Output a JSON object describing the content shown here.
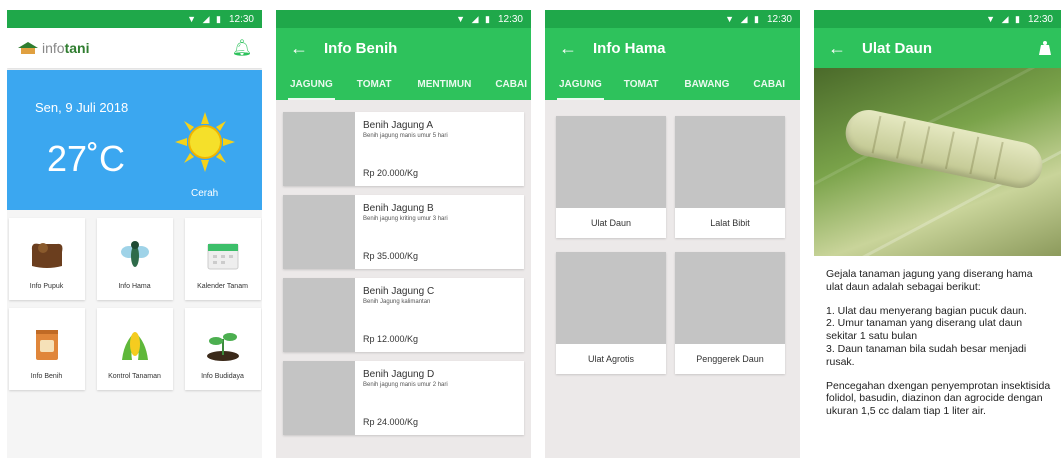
{
  "status": {
    "time": "12:30",
    "icons": "▼ ◢ ▮"
  },
  "home": {
    "logo_info": "info",
    "logo_tani": "tani",
    "weather": {
      "date": "Sen, 9 Juli 2018",
      "temp": "27˚C",
      "condition": "Cerah"
    },
    "tiles": [
      {
        "label": "Info Pupuk",
        "icon": "fertilizer-bag-icon"
      },
      {
        "label": "Info Hama",
        "icon": "insect-icon"
      },
      {
        "label": "Kalender Tanam",
        "icon": "calendar-icon"
      },
      {
        "label": "Info Benih",
        "icon": "seed-packet-icon"
      },
      {
        "label": "Kontrol Tanaman",
        "icon": "corn-icon"
      },
      {
        "label": "Info Budidaya",
        "icon": "sprout-icon"
      }
    ]
  },
  "benih": {
    "title": "Info Benih",
    "tabs": [
      "JAGUNG",
      "TOMAT",
      "MENTIMUN",
      "CABAI"
    ],
    "items": [
      {
        "name": "Benih Jagung A",
        "desc": "Benih jagung manis umur 5 hari",
        "price": "Rp 20.000/Kg"
      },
      {
        "name": "Benih Jagung B",
        "desc": "Benih jagung kriting umur 3 hari",
        "price": "Rp 35.000/Kg"
      },
      {
        "name": "Benih Jagung C",
        "desc": "Benih Jagung kalimantan",
        "price": "Rp 12.000/Kg"
      },
      {
        "name": "Benih Jagung D",
        "desc": "Benih jagung manis umur 2 hari",
        "price": "Rp 24.000/Kg"
      }
    ]
  },
  "hama": {
    "title": "Info Hama",
    "tabs": [
      "JAGUNG",
      "TOMAT",
      "BAWANG",
      "CABAI"
    ],
    "items": [
      "Ulat Daun",
      "Lalat Bibit",
      "Ulat Agrotis",
      "Penggerek Daun"
    ]
  },
  "detail": {
    "title": "Ulat Daun",
    "intro": "Gejala tanaman jagung yang diserang hama ulat daun adalah sebagai berikut:",
    "points": "1. Ulat dau menyerang bagian pucuk daun.\n2. Umur tanaman yang diserang ulat daun sekitar 1 satu bulan\n3. Daun tanaman bila sudah besar menjadi rusak.",
    "prevention": "Pencegahan dxengan penyemprotan insektisida folidol, basudin, diazinon dan agrocide dengan ukuran 1,5 cc dalam tiap 1 liter air."
  },
  "colors": {
    "primary": "#2ec25c",
    "status": "#1fa84a",
    "weather": "#3ba7f0"
  }
}
